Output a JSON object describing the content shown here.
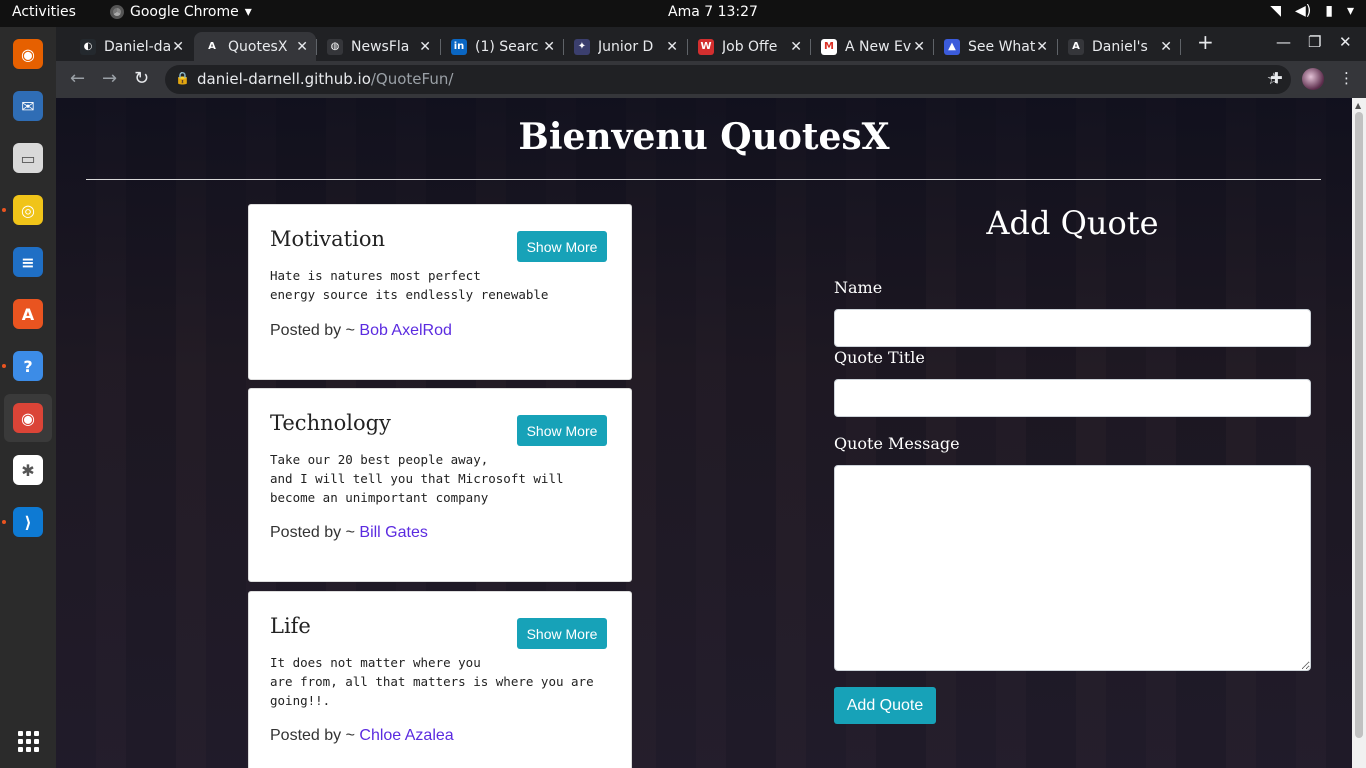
{
  "topbar": {
    "activities": "Activities",
    "app_name": "Google Chrome",
    "clock": "Ama 7  13:27"
  },
  "dock": {
    "items": [
      {
        "name": "firefox",
        "color": "#e66000",
        "glyph": "◉"
      },
      {
        "name": "thunderbird",
        "color": "#2f6db5",
        "glyph": "✉"
      },
      {
        "name": "files",
        "color": "#d9d9d9",
        "glyph": "▭"
      },
      {
        "name": "rhythmbox",
        "color": "#f0c419",
        "glyph": "◎"
      },
      {
        "name": "libreoffice-writer",
        "color": "#1f6fc5",
        "glyph": "≡"
      },
      {
        "name": "ubuntu-software",
        "color": "#e95420",
        "glyph": "A"
      },
      {
        "name": "help",
        "color": "#3c8ce7",
        "glyph": "?"
      },
      {
        "name": "chrome",
        "color": "#db4437",
        "glyph": "◉"
      },
      {
        "name": "slack",
        "color": "#ffffff",
        "glyph": "✱"
      },
      {
        "name": "vscode",
        "color": "#0e7ad3",
        "glyph": "⟩"
      }
    ]
  },
  "tabs": [
    {
      "title": "Daniel-da",
      "fav": "#24292e",
      "glyph": "◐"
    },
    {
      "title": "QuotesX",
      "fav": "#35363a",
      "glyph": "A"
    },
    {
      "title": "NewsFla",
      "fav": "#35363a",
      "glyph": "◍"
    },
    {
      "title": "(1) Searc",
      "fav": "#0a66c2",
      "glyph": "in"
    },
    {
      "title": "Junior D",
      "fav": "#3b3f6e",
      "glyph": "✦"
    },
    {
      "title": "Job Offe",
      "fav": "#d32f2f",
      "glyph": "W"
    },
    {
      "title": "A New Ev",
      "fav": "#ffffff",
      "glyph": "M"
    },
    {
      "title": "See What",
      "fav": "#3b5bdb",
      "glyph": "▲"
    },
    {
      "title": "Daniel's",
      "fav": "#35363a",
      "glyph": "A"
    }
  ],
  "address": {
    "host": "daniel-darnell.github.io",
    "path": "/QuoteFun/"
  },
  "page": {
    "heading": "Bienvenu QuotesX",
    "quotes": [
      {
        "title": "Motivation",
        "message": "Hate is natures most perfect\nenergy source its endlessly renewable",
        "posted_by": "Posted by ~ ",
        "author": "Bob AxelRod",
        "button": "Show More"
      },
      {
        "title": "Technology",
        "message": "Take our 20 best people away,\nand I will tell you that Microsoft will\nbecome an unimportant company",
        "posted_by": "Posted by ~ ",
        "author": "Bill Gates",
        "button": "Show More"
      },
      {
        "title": "Life",
        "message": "It does not matter where you\nare from, all that matters is where you are\ngoing!!.",
        "posted_by": "Posted by ~ ",
        "author": "Chloe Azalea",
        "button": "Show More"
      }
    ],
    "form": {
      "title": "Add Quote",
      "name_label": "Name",
      "name_value": "",
      "quote_title_label": "Quote Title",
      "quote_title_value": "",
      "message_label": "Quote Message",
      "message_value": "",
      "submit": "Add Quote"
    }
  },
  "colors": {
    "accent": "#17a2b8",
    "link": "#5b2be0"
  }
}
